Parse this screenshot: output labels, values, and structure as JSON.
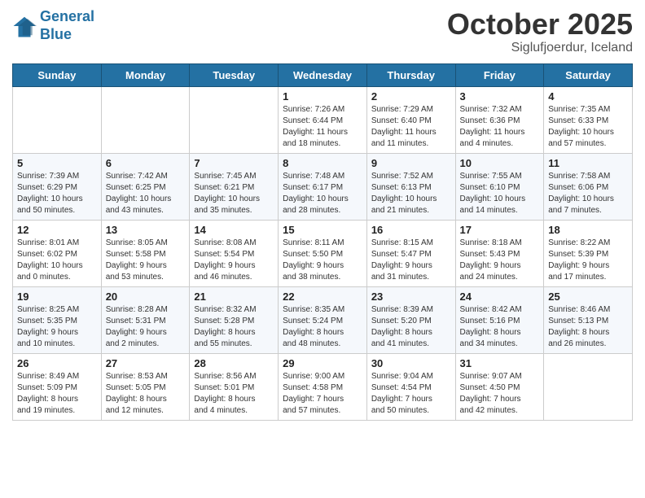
{
  "logo": {
    "line1": "General",
    "line2": "Blue"
  },
  "title": "October 2025",
  "subtitle": "Siglufjoerdur, Iceland",
  "weekdays": [
    "Sunday",
    "Monday",
    "Tuesday",
    "Wednesday",
    "Thursday",
    "Friday",
    "Saturday"
  ],
  "weeks": [
    [
      {
        "day": "",
        "info": ""
      },
      {
        "day": "",
        "info": ""
      },
      {
        "day": "",
        "info": ""
      },
      {
        "day": "1",
        "info": "Sunrise: 7:26 AM\nSunset: 6:44 PM\nDaylight: 11 hours\nand 18 minutes."
      },
      {
        "day": "2",
        "info": "Sunrise: 7:29 AM\nSunset: 6:40 PM\nDaylight: 11 hours\nand 11 minutes."
      },
      {
        "day": "3",
        "info": "Sunrise: 7:32 AM\nSunset: 6:36 PM\nDaylight: 11 hours\nand 4 minutes."
      },
      {
        "day": "4",
        "info": "Sunrise: 7:35 AM\nSunset: 6:33 PM\nDaylight: 10 hours\nand 57 minutes."
      }
    ],
    [
      {
        "day": "5",
        "info": "Sunrise: 7:39 AM\nSunset: 6:29 PM\nDaylight: 10 hours\nand 50 minutes."
      },
      {
        "day": "6",
        "info": "Sunrise: 7:42 AM\nSunset: 6:25 PM\nDaylight: 10 hours\nand 43 minutes."
      },
      {
        "day": "7",
        "info": "Sunrise: 7:45 AM\nSunset: 6:21 PM\nDaylight: 10 hours\nand 35 minutes."
      },
      {
        "day": "8",
        "info": "Sunrise: 7:48 AM\nSunset: 6:17 PM\nDaylight: 10 hours\nand 28 minutes."
      },
      {
        "day": "9",
        "info": "Sunrise: 7:52 AM\nSunset: 6:13 PM\nDaylight: 10 hours\nand 21 minutes."
      },
      {
        "day": "10",
        "info": "Sunrise: 7:55 AM\nSunset: 6:10 PM\nDaylight: 10 hours\nand 14 minutes."
      },
      {
        "day": "11",
        "info": "Sunrise: 7:58 AM\nSunset: 6:06 PM\nDaylight: 10 hours\nand 7 minutes."
      }
    ],
    [
      {
        "day": "12",
        "info": "Sunrise: 8:01 AM\nSunset: 6:02 PM\nDaylight: 10 hours\nand 0 minutes."
      },
      {
        "day": "13",
        "info": "Sunrise: 8:05 AM\nSunset: 5:58 PM\nDaylight: 9 hours\nand 53 minutes."
      },
      {
        "day": "14",
        "info": "Sunrise: 8:08 AM\nSunset: 5:54 PM\nDaylight: 9 hours\nand 46 minutes."
      },
      {
        "day": "15",
        "info": "Sunrise: 8:11 AM\nSunset: 5:50 PM\nDaylight: 9 hours\nand 38 minutes."
      },
      {
        "day": "16",
        "info": "Sunrise: 8:15 AM\nSunset: 5:47 PM\nDaylight: 9 hours\nand 31 minutes."
      },
      {
        "day": "17",
        "info": "Sunrise: 8:18 AM\nSunset: 5:43 PM\nDaylight: 9 hours\nand 24 minutes."
      },
      {
        "day": "18",
        "info": "Sunrise: 8:22 AM\nSunset: 5:39 PM\nDaylight: 9 hours\nand 17 minutes."
      }
    ],
    [
      {
        "day": "19",
        "info": "Sunrise: 8:25 AM\nSunset: 5:35 PM\nDaylight: 9 hours\nand 10 minutes."
      },
      {
        "day": "20",
        "info": "Sunrise: 8:28 AM\nSunset: 5:31 PM\nDaylight: 9 hours\nand 2 minutes."
      },
      {
        "day": "21",
        "info": "Sunrise: 8:32 AM\nSunset: 5:28 PM\nDaylight: 8 hours\nand 55 minutes."
      },
      {
        "day": "22",
        "info": "Sunrise: 8:35 AM\nSunset: 5:24 PM\nDaylight: 8 hours\nand 48 minutes."
      },
      {
        "day": "23",
        "info": "Sunrise: 8:39 AM\nSunset: 5:20 PM\nDaylight: 8 hours\nand 41 minutes."
      },
      {
        "day": "24",
        "info": "Sunrise: 8:42 AM\nSunset: 5:16 PM\nDaylight: 8 hours\nand 34 minutes."
      },
      {
        "day": "25",
        "info": "Sunrise: 8:46 AM\nSunset: 5:13 PM\nDaylight: 8 hours\nand 26 minutes."
      }
    ],
    [
      {
        "day": "26",
        "info": "Sunrise: 8:49 AM\nSunset: 5:09 PM\nDaylight: 8 hours\nand 19 minutes."
      },
      {
        "day": "27",
        "info": "Sunrise: 8:53 AM\nSunset: 5:05 PM\nDaylight: 8 hours\nand 12 minutes."
      },
      {
        "day": "28",
        "info": "Sunrise: 8:56 AM\nSunset: 5:01 PM\nDaylight: 8 hours\nand 4 minutes."
      },
      {
        "day": "29",
        "info": "Sunrise: 9:00 AM\nSunset: 4:58 PM\nDaylight: 7 hours\nand 57 minutes."
      },
      {
        "day": "30",
        "info": "Sunrise: 9:04 AM\nSunset: 4:54 PM\nDaylight: 7 hours\nand 50 minutes."
      },
      {
        "day": "31",
        "info": "Sunrise: 9:07 AM\nSunset: 4:50 PM\nDaylight: 7 hours\nand 42 minutes."
      },
      {
        "day": "",
        "info": ""
      }
    ]
  ]
}
